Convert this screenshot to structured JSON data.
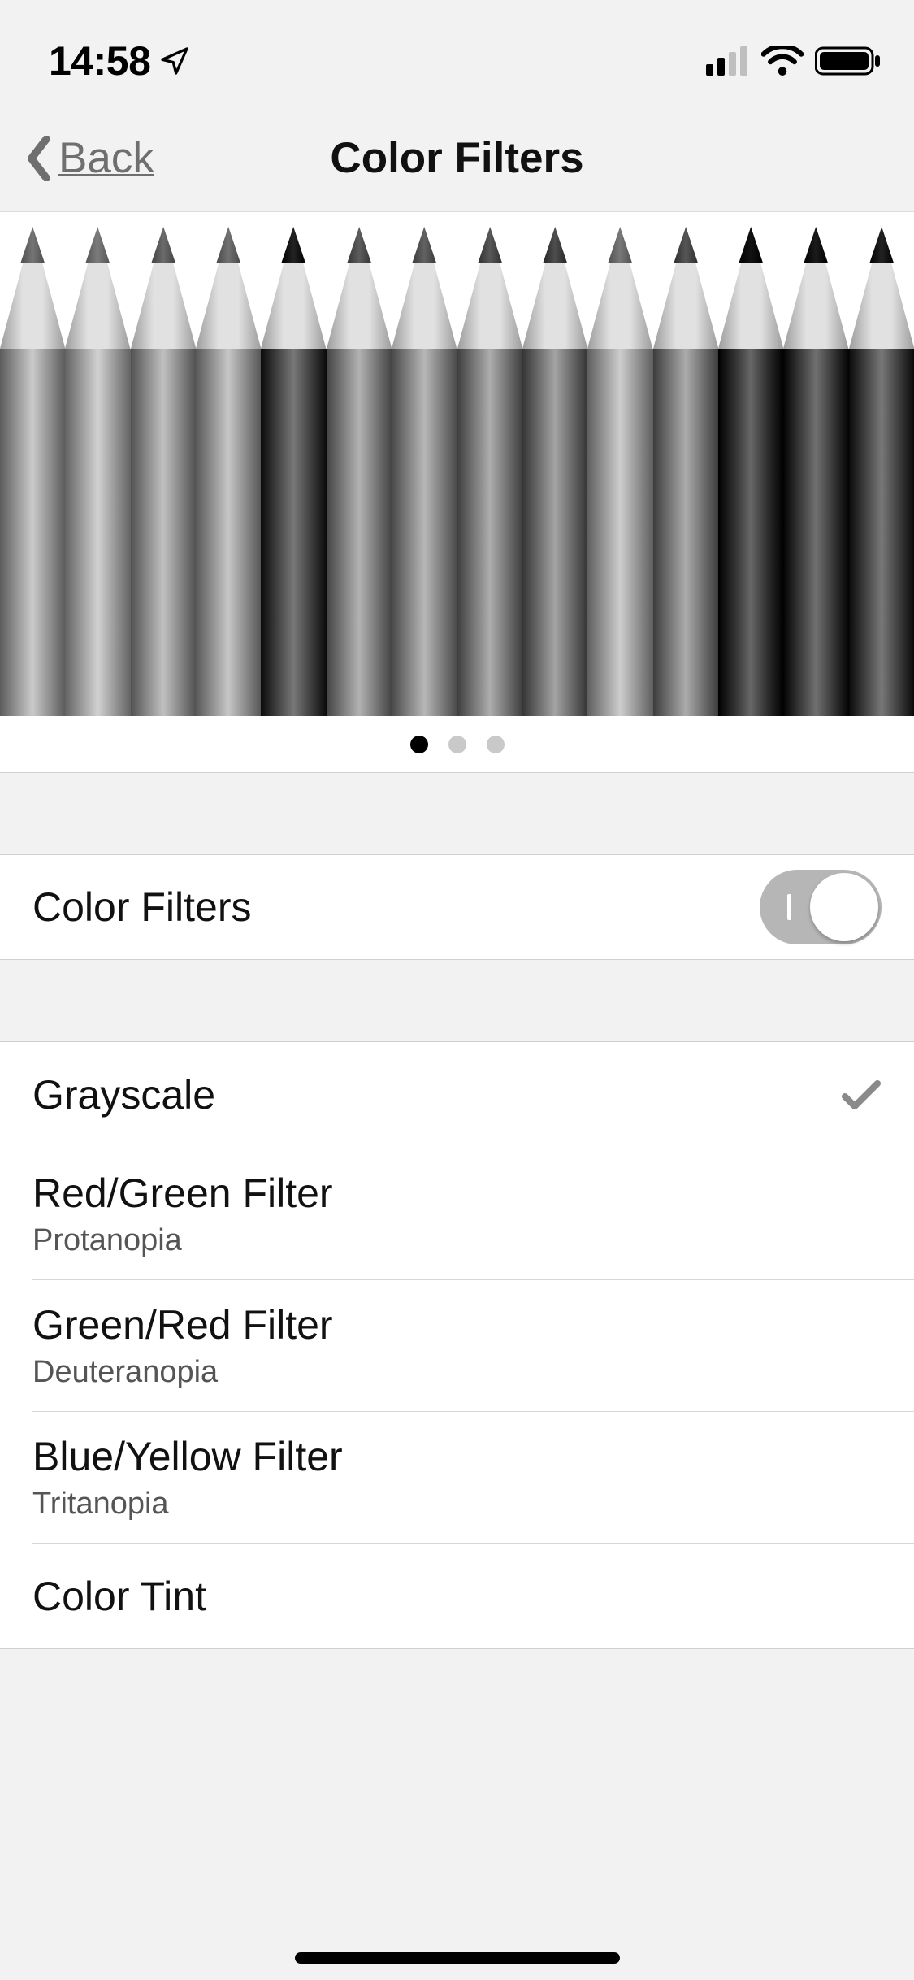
{
  "status": {
    "time": "14:58"
  },
  "nav": {
    "back_label": "Back",
    "title": "Color Filters"
  },
  "preview": {
    "page_dots": {
      "count": 3,
      "active": 0
    },
    "pencil_grays": [
      "#939393",
      "#9a9a9a",
      "#898989",
      "#8f8f8f",
      "#414141",
      "#7b7b7b",
      "#808080",
      "#767676",
      "#6c6c6c",
      "#969696",
      "#747474",
      "#303030",
      "#393939",
      "#414141"
    ]
  },
  "toggle_row": {
    "label": "Color Filters",
    "on": true
  },
  "filters": [
    {
      "title": "Grayscale",
      "subtitle": "",
      "selected": true
    },
    {
      "title": "Red/Green Filter",
      "subtitle": "Protanopia",
      "selected": false
    },
    {
      "title": "Green/Red Filter",
      "subtitle": "Deuteranopia",
      "selected": false
    },
    {
      "title": "Blue/Yellow Filter",
      "subtitle": "Tritanopia",
      "selected": false
    },
    {
      "title": "Color Tint",
      "subtitle": "",
      "selected": false
    }
  ]
}
